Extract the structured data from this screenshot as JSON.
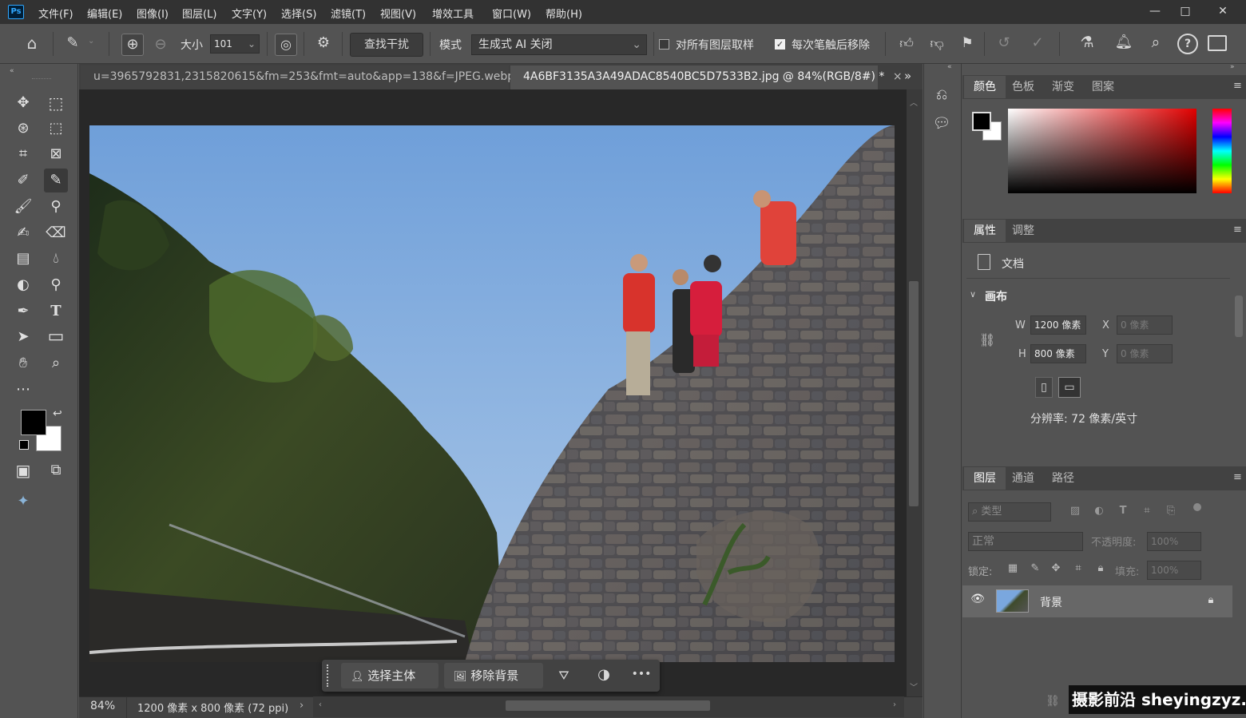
{
  "app": {
    "logo": "Ps"
  },
  "menu": [
    "文件(F)",
    "编辑(E)",
    "图像(I)",
    "图层(L)",
    "文字(Y)",
    "选择(S)",
    "滤镜(T)",
    "视图(V)",
    "增效工具",
    "窗口(W)",
    "帮助(H)"
  ],
  "window_controls": {
    "minimize": "—",
    "maximize": "□",
    "close": "✕"
  },
  "options": {
    "size_label": "大小",
    "size_value": "101",
    "find_distractions": "查找干扰",
    "mode_label": "模式",
    "mode_value": "生成式 AI 关闭",
    "sample_all_layers": "对所有图层取样",
    "sample_all_checked": false,
    "remove_after_stroke": "每次笔触后移除",
    "remove_after_checked": true
  },
  "tabs": [
    {
      "label": "u=3965792831,2315820615&fm=253&fmt=auto&app=138&f=JPEG.webp",
      "close": "×",
      "active": false
    },
    {
      "label": "4A6BF3135A3A49ADAC8540BC5D7533B2.jpg @ 84%(RGB/8#) *",
      "close": "×",
      "active": true
    }
  ],
  "tabs_overflow": "»",
  "statusbar": {
    "zoom": "84%",
    "doc_info": "1200 像素 x 800 像素 (72 ppi)",
    "arrow": "›"
  },
  "taskbar": {
    "select_subject": "选择主体",
    "remove_background": "移除背景",
    "more": "•••"
  },
  "color_panel": {
    "tabs": [
      "颜色",
      "色板",
      "渐变",
      "图案"
    ],
    "foreground": "#000000",
    "background": "#ffffff"
  },
  "properties_panel": {
    "tabs": [
      "属性",
      "调整"
    ],
    "doc_label": "文档",
    "canvas_section": "画布",
    "w_label": "W",
    "w_value": "1200 像素",
    "h_label": "H",
    "h_value": "800 像素",
    "x_label": "X",
    "x_value": "0 像素",
    "y_label": "Y",
    "y_value": "0 像素",
    "resolution": "分辨率: 72 像素/英寸"
  },
  "layers_panel": {
    "tabs": [
      "图层",
      "通道",
      "路径"
    ],
    "filter_label": "类型",
    "blend_mode": "正常",
    "opacity_label": "不透明度:",
    "opacity_value": "100%",
    "lock_label": "锁定:",
    "fill_label": "填充:",
    "fill_value": "100%",
    "layers": [
      {
        "name": "背景",
        "visible": true,
        "locked": true
      }
    ]
  },
  "watermark": "摄影前沿 sheyingzyz.com",
  "colors": {
    "accent": "#31a8ff",
    "menubar": "#323232",
    "panel": "#535353",
    "canvas_bg": "#282828"
  }
}
